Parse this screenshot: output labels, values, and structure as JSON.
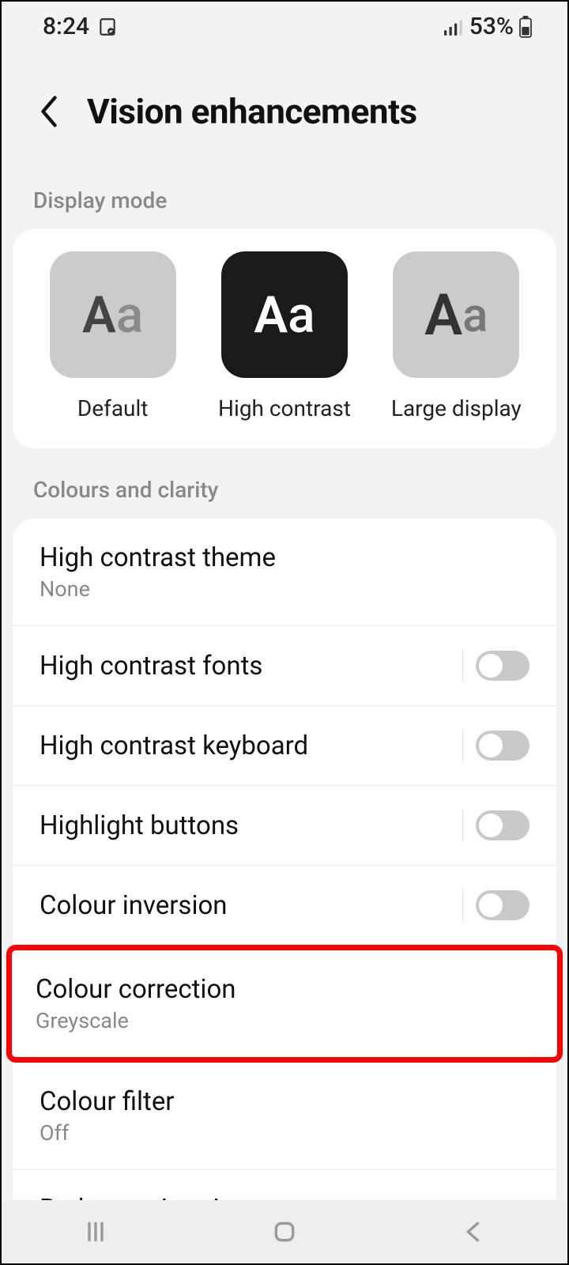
{
  "status": {
    "time": "8:24",
    "battery": "53%"
  },
  "header": {
    "title": "Vision enhancements"
  },
  "sections": {
    "display_mode_label": "Display mode",
    "colours_label": "Colours and clarity"
  },
  "display_modes": {
    "default": "Default",
    "high_contrast": "High contrast",
    "large_display": "Large display"
  },
  "settings": {
    "high_contrast_theme": {
      "title": "High contrast theme",
      "sub": "None"
    },
    "high_contrast_fonts": {
      "title": "High contrast fonts"
    },
    "high_contrast_keyboard": {
      "title": "High contrast keyboard"
    },
    "highlight_buttons": {
      "title": "Highlight buttons"
    },
    "colour_inversion": {
      "title": "Colour inversion"
    },
    "colour_correction": {
      "title": "Colour correction",
      "sub": "Greyscale"
    },
    "colour_filter": {
      "title": "Colour filter",
      "sub": "Off"
    },
    "reduce_animations": {
      "title": "Reduce animations"
    }
  }
}
